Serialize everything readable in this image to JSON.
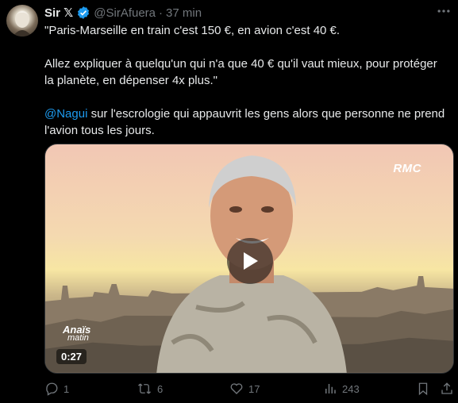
{
  "tweet": {
    "author_name": "Sir 𝕏",
    "handle": "@SirAfuera",
    "separator": "·",
    "time": "37 min",
    "text_line1": "\"Paris-Marseille en train c'est 150 €, en avion c'est 40 €.",
    "text_para2": "Allez expliquer à quelqu'un qui n'a que 40 € qu'il vaut mieux, pour protéger la planète, en dépenser 4x plus.\"",
    "mention": "@Nagui",
    "text_para3_rest": " sur l'escrologie qui appauvrit les gens alors que personne ne prend l'avion tous les jours."
  },
  "media": {
    "channel_logo": "RMC",
    "show_logo_line1": "Anaïs",
    "show_logo_line2": "matin",
    "duration": "0:27"
  },
  "actions": {
    "replies": "1",
    "reposts": "6",
    "likes": "17",
    "views": "243"
  },
  "colors": {
    "accent": "#1d9bf0",
    "muted": "#71767b",
    "background": "#000000",
    "text": "#e7e9ea"
  },
  "icons": [
    "verified-badge-icon",
    "more-icon",
    "play-icon",
    "reply-icon",
    "repost-icon",
    "like-icon",
    "views-icon",
    "bookmark-icon",
    "share-icon"
  ]
}
